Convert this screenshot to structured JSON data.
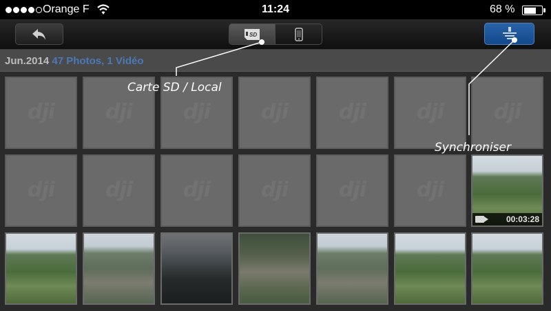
{
  "status_bar": {
    "carrier": "Orange F",
    "time": "11:24",
    "battery_percent": "68 %",
    "battery_level": 0.68,
    "signal_bars": 4,
    "signal_max": 5
  },
  "toolbar": {
    "back_icon": "back-arrow-icon",
    "source_segment": [
      {
        "name": "sd-card",
        "label": "SD",
        "icon": "sd-card-icon",
        "selected": true
      },
      {
        "name": "local",
        "label": "",
        "icon": "phone-icon",
        "selected": false
      }
    ],
    "sync_icon": "sync-icon",
    "accent_color": "#2a62a8"
  },
  "gallery": {
    "month": "Jun.2014",
    "count": "47 Photos, 1 Vidéo",
    "rows": [
      [
        "placeholder",
        "placeholder",
        "placeholder",
        "placeholder",
        "placeholder",
        "placeholder",
        "placeholder"
      ],
      [
        "placeholder",
        "placeholder",
        "placeholder",
        "placeholder",
        "placeholder",
        "placeholder",
        "video"
      ],
      [
        "photo-fields",
        "photo-village",
        "photo-dark",
        "photo-town",
        "photo-village",
        "photo-fields",
        "photo-fields"
      ]
    ],
    "video_duration": "00:03:28",
    "placeholder_logo": "dji"
  },
  "annotations": {
    "sd_local": "Carte SD / Local",
    "sync": "Synchroniser"
  }
}
